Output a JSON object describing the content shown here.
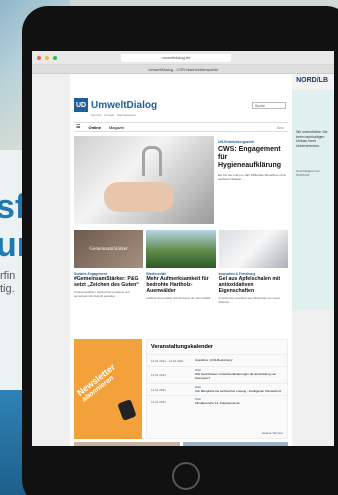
{
  "background": {
    "big_text_line1": "sf",
    "big_text_line2": "ur",
    "small_text_line1": "rfin",
    "small_text_line2": "tig."
  },
  "browser": {
    "url": "umweltdialog.de",
    "tab_title": "UmweltDialog - CSR-Nachrichtenportal"
  },
  "ads": {
    "top_brand": "NORD/LB",
    "side_text": "Wir unterstützen Sie beim nachhaltigen Umbau Ihres Unternehmens.",
    "side_small": "Nachhaltigkeit bei NORD/LB"
  },
  "site": {
    "logo_initials": "UD",
    "logo_name": "UmweltDialog",
    "logo_sub": "Mensch · Umwelt · Nachhaltigkeit",
    "search_placeholder": "Suche"
  },
  "nav": {
    "menu_icon": "☰",
    "items": [
      "Online",
      "Magazin"
    ],
    "abo": "Abo"
  },
  "hero": {
    "kicker": "UN-Entwicklungsziele",
    "title": "CWS: Engagement für Hygieneaufklärung",
    "teaser": "Ein bis vier mal pro Jahr Milliarden Menschen ohne sauberes Wasser ..."
  },
  "cards": [
    {
      "image_label": "GemeinsamStärker",
      "kicker": "Soziales Engagement",
      "title": "#GemeinsamStärker: P&G setzt „Zeichen des Guten“",
      "text": "Zusammenhalten, füreinander einstehen und gemeinsam die Zukunft gestalten ..."
    },
    {
      "image_label": "",
      "kicker": "Biodiversität",
      "title": "Mehr Aufmerksamkeit für bedrohte Hartholz-Auenwälder",
      "text": "Hartholz-Auenwälder sind Hotspots der Artenvielfalt ..."
    },
    {
      "image_label": "",
      "kicker": "Innovation & Forschung",
      "title": "Gel aus Apfelschalen mit antioxidativen Eigenschaften",
      "text": "Forschende entwickeln aus Obstresten ein neues Material ..."
    }
  ],
  "newsletter": {
    "line1": "Newsletter",
    "line2": "abonnieren"
  },
  "events": {
    "title": "Veranstaltungskalender",
    "rows": [
      {
        "date": "13.01.2021 - 14.01.2021",
        "loc": "",
        "name": "Grandbox „CO2-Beprobung“"
      },
      {
        "date": "13.01.2021",
        "loc": "Web",
        "name": "Wie beeinflussen Umweltveränderungen die Entwicklung von Zoonosen?"
      },
      {
        "date": "14.01.2021",
        "loc": "Web",
        "name": "Von Biosphäre bis technischer Lösung - Intelligenter Klimaschutz"
      },
      {
        "date": "14.01.2021",
        "loc": "Web",
        "name": "Klimakonzerte 14 „Küppelemente“"
      }
    ],
    "more": "weitere Termine"
  },
  "colors": {
    "brand": "#1f5e9c",
    "newsletter": "#f3a23b",
    "nordlb": "#173a6b"
  }
}
